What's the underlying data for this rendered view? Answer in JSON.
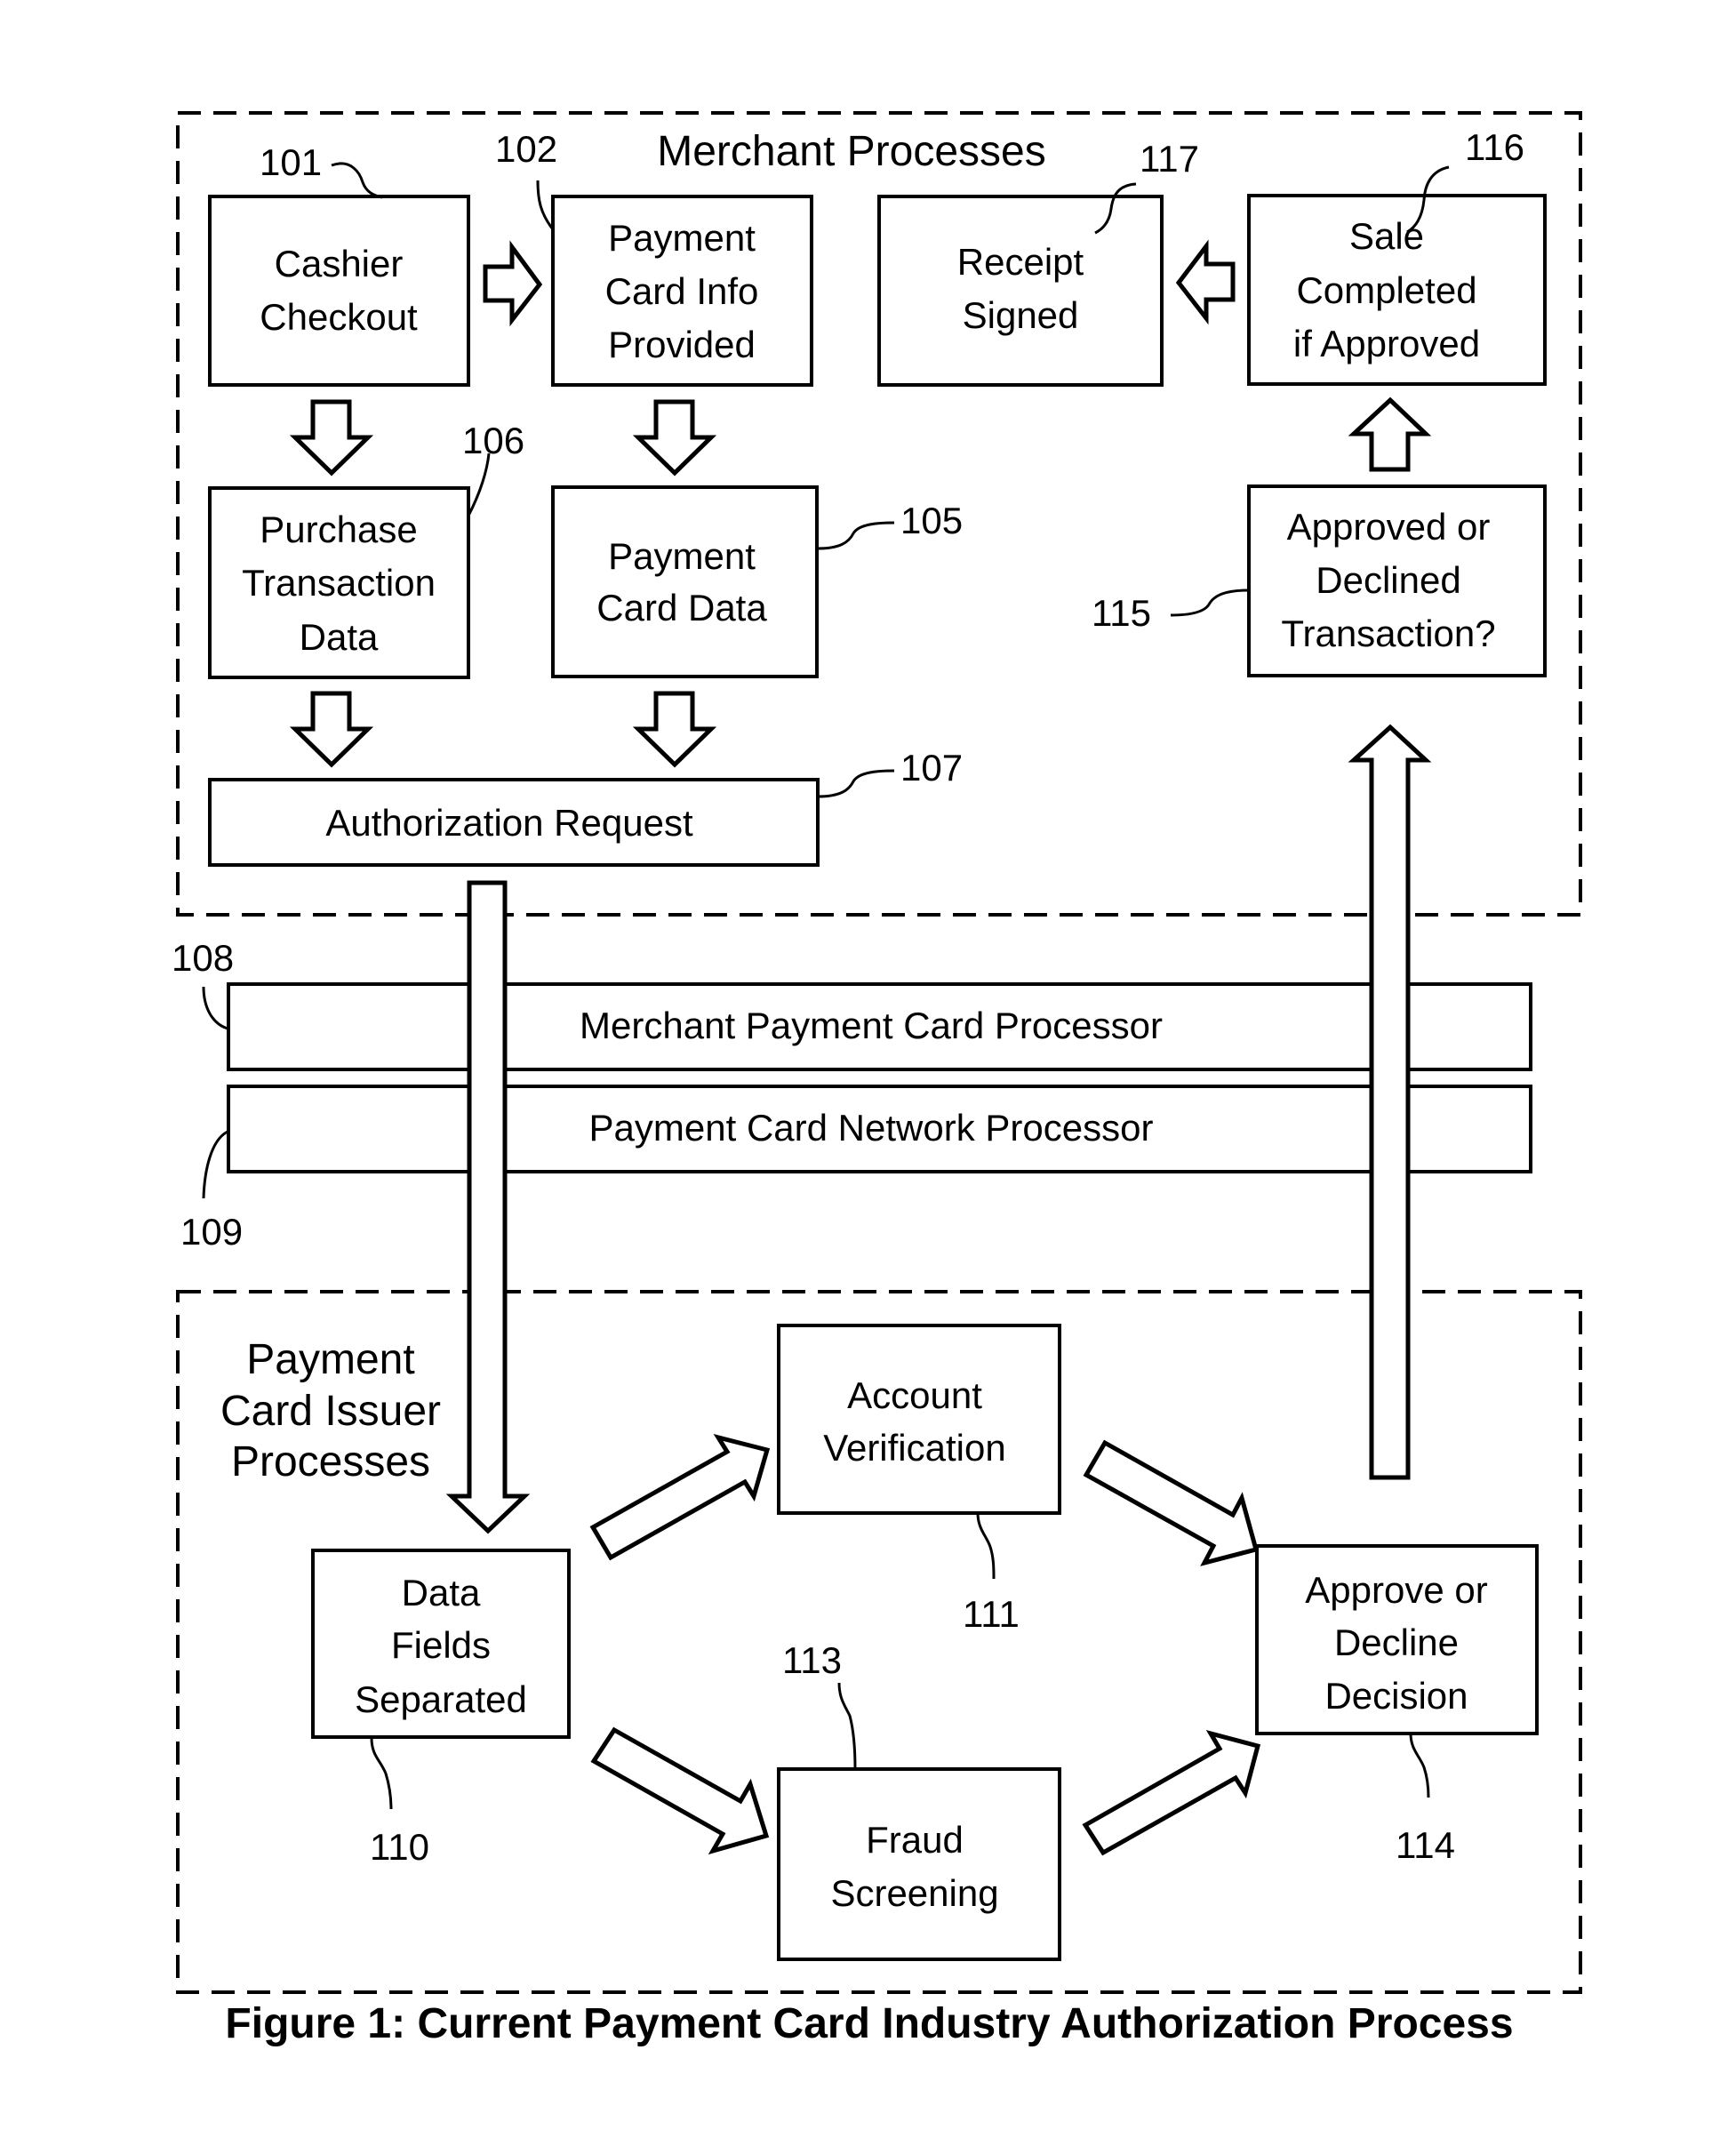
{
  "figure": {
    "caption": "Figure 1: Current Payment Card Industry Authorization Process",
    "ink_color": "#000000",
    "background_color": "#ffffff"
  },
  "merchant_group": {
    "title": "Merchant Processes",
    "boxes": {
      "cashier_checkout": {
        "ref": "101",
        "lines": [
          "Cashier",
          "Checkout"
        ]
      },
      "payment_card_info": {
        "ref": "102",
        "lines": [
          "Payment",
          "Card Info",
          "Provided"
        ]
      },
      "receipt_signed": {
        "ref": "117",
        "lines": [
          "Receipt",
          "Signed"
        ]
      },
      "sale_completed": {
        "ref": "116",
        "lines": [
          "Sale",
          "Completed",
          "if Approved"
        ]
      },
      "purchase_data": {
        "ref": "106",
        "lines": [
          "Purchase",
          "Transaction",
          "Data"
        ]
      },
      "payment_card_data": {
        "ref": "105",
        "lines": [
          "Payment",
          "Card Data"
        ]
      },
      "approved_declined": {
        "ref": "115",
        "lines": [
          "Approved or",
          "Declined",
          "Transaction?"
        ]
      },
      "authorization_request": {
        "ref": "107",
        "lines": [
          "Authorization Request"
        ]
      }
    }
  },
  "processors": {
    "merchant_processor": {
      "ref": "108",
      "label": "Merchant Payment Card Processor"
    },
    "network_processor": {
      "ref": "109",
      "label": "Payment Card Network Processor"
    }
  },
  "issuer_group": {
    "title_lines": [
      "Payment",
      "Card Issuer",
      "Processes"
    ],
    "boxes": {
      "data_fields": {
        "ref": "110",
        "lines": [
          "Data",
          "Fields",
          "Separated"
        ]
      },
      "account_verification": {
        "ref": "111",
        "lines": [
          "Account",
          "Verification"
        ]
      },
      "fraud_screening": {
        "ref": "113",
        "lines": [
          "Fraud",
          "Screening"
        ]
      },
      "approve_decline": {
        "ref": "114",
        "lines": [
          "Approve or",
          "Decline",
          "Decision"
        ]
      }
    }
  }
}
